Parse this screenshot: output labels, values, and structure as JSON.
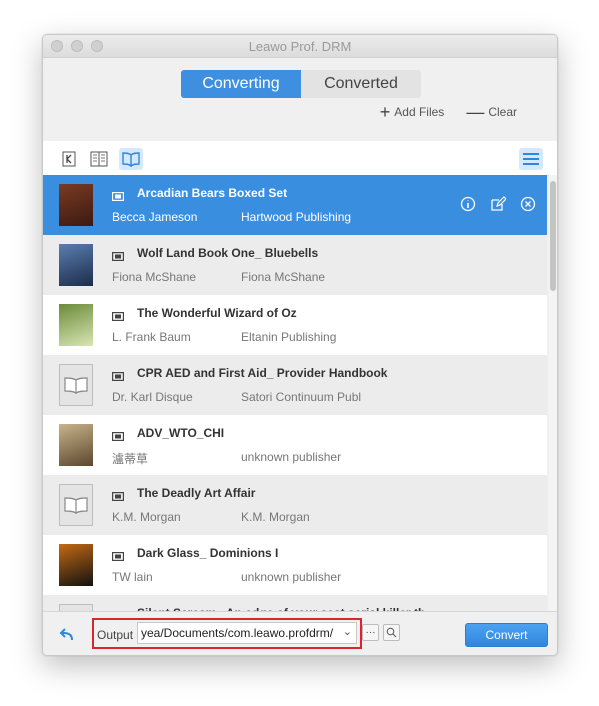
{
  "window": {
    "title": "Leawo Prof. DRM"
  },
  "tabs": {
    "converting": "Converting",
    "converted": "Converted"
  },
  "actions": {
    "add_files": "Add Files",
    "clear": "Clear"
  },
  "books": [
    {
      "title": "Arcadian Bears Boxed Set",
      "author": "Becca Jameson",
      "publisher": "Hartwood Publishing",
      "thumb": "cover-dark-red",
      "selected": true
    },
    {
      "title": "Wolf Land Book One_ Bluebells",
      "author": "Fiona McShane",
      "publisher": "Fiona McShane",
      "thumb": "cover-blue"
    },
    {
      "title": "The Wonderful Wizard of Oz",
      "author": "L. Frank Baum",
      "publisher": "Eltanin Publishing",
      "thumb": "cover-green"
    },
    {
      "title": "CPR AED and First Aid_ Provider Handbook",
      "author": "Dr. Karl Disque",
      "publisher": "Satori Continuum Publ",
      "thumb": "book-placeholder-icon"
    },
    {
      "title": "ADV_WTO_CHI",
      "author": "瀘蒂草",
      "publisher": "unknown publisher",
      "thumb": "cover-brown"
    },
    {
      "title": "The Deadly Art Affair",
      "author": "K.M. Morgan",
      "publisher": "K.M. Morgan",
      "thumb": "book-placeholder-icon"
    },
    {
      "title": "Dark Glass_ Dominions I",
      "author": "TW lain",
      "publisher": "unknown publisher",
      "thumb": "cover-orange"
    },
    {
      "title": "Silent Scream_ An edge of your seat serial killer th",
      "author": "",
      "publisher": "",
      "thumb": "book-placeholder-icon"
    }
  ],
  "footer": {
    "output_label": "Output",
    "output_path": "yea/Documents/com.leawo.profdrm/",
    "convert_label": "Convert"
  },
  "colors": {
    "accent": "#3a8ee0",
    "highlight_border": "#d9262c"
  }
}
